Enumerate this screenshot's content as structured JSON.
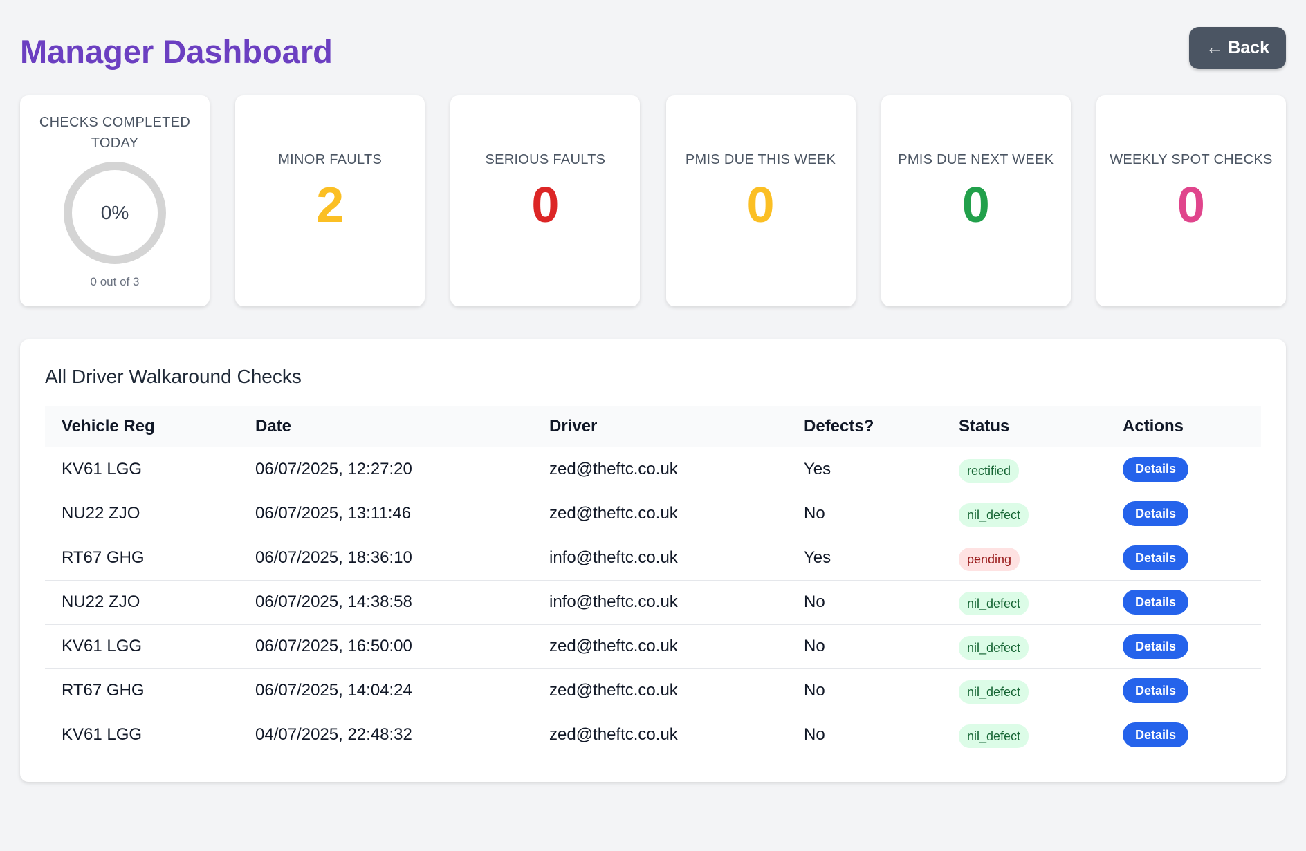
{
  "header": {
    "title": "Manager Dashboard",
    "back_label": "← Back"
  },
  "stats": {
    "checks_today": {
      "label": "Checks Completed Today",
      "percent_text": "0%",
      "sub": "0 out of 3",
      "completed": 0,
      "total": 3,
      "ring_color": "#d4d4d4"
    },
    "minor_faults": {
      "label": "Minor Faults",
      "value": "2",
      "color": "#fbbf24"
    },
    "serious_faults": {
      "label": "Serious Faults",
      "value": "0",
      "color": "#dc2626"
    },
    "pmis_this_week": {
      "label": "PMIs Due This Week",
      "value": "0",
      "color": "#fbbf24"
    },
    "pmis_next_week": {
      "label": "PMIs Due Next Week",
      "value": "0",
      "color": "#22a04b"
    },
    "weekly_spot": {
      "label": "Weekly Spot Checks",
      "value": "0",
      "color": "#e0458c"
    }
  },
  "checks_panel": {
    "title": "All Driver Walkaround Checks",
    "columns": [
      "Vehicle Reg",
      "Date",
      "Driver",
      "Defects?",
      "Status",
      "Actions"
    ],
    "details_label": "Details",
    "rows": [
      {
        "reg": "KV61 LGG",
        "date": "06/07/2025, 12:27:20",
        "driver": "zed@theftc.co.uk",
        "defects": "Yes",
        "status": "rectified"
      },
      {
        "reg": "NU22 ZJO",
        "date": "06/07/2025, 13:11:46",
        "driver": "zed@theftc.co.uk",
        "defects": "No",
        "status": "nil_defect"
      },
      {
        "reg": "RT67 GHG",
        "date": "06/07/2025, 18:36:10",
        "driver": "info@theftc.co.uk",
        "defects": "Yes",
        "status": "pending"
      },
      {
        "reg": "NU22 ZJO",
        "date": "06/07/2025, 14:38:58",
        "driver": "info@theftc.co.uk",
        "defects": "No",
        "status": "nil_defect"
      },
      {
        "reg": "KV61 LGG",
        "date": "06/07/2025, 16:50:00",
        "driver": "zed@theftc.co.uk",
        "defects": "No",
        "status": "nil_defect"
      },
      {
        "reg": "RT67 GHG",
        "date": "06/07/2025, 14:04:24",
        "driver": "zed@theftc.co.uk",
        "defects": "No",
        "status": "nil_defect"
      },
      {
        "reg": "KV61 LGG",
        "date": "04/07/2025, 22:48:32",
        "driver": "zed@theftc.co.uk",
        "defects": "No",
        "status": "nil_defect"
      }
    ]
  }
}
